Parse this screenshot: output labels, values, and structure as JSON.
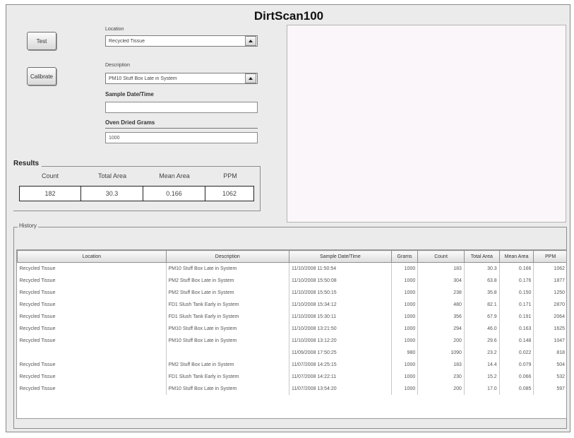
{
  "app": {
    "title": "DirtScan100"
  },
  "buttons": {
    "test_label": "Test",
    "calibrate_label": "Calibrate"
  },
  "location": {
    "label": "Location",
    "value": "Recycled Tissue"
  },
  "description": {
    "label": "Description",
    "value": "PM10 Stuff Box Late in System"
  },
  "sample_datetime": {
    "label": "Sample Date/Time",
    "value": ""
  },
  "oven_dried_grams": {
    "label": "Oven Dried Grams",
    "value": "1000"
  },
  "results": {
    "title": "Results",
    "headers": [
      "Count",
      "Total Area",
      "Mean Area",
      "PPM"
    ],
    "values": [
      "182",
      "30.3",
      "0.166",
      "1062"
    ]
  },
  "history": {
    "title": "History",
    "columns": [
      "Location",
      "Description",
      "Sample Date/Time",
      "Grams",
      "Count",
      "Total Area",
      "Mean Area",
      "PPM"
    ],
    "rows": [
      [
        "Recycled Tissue",
        "PM10 Stuff Box Late in System",
        "11/10/2008 11:50:54",
        "1000",
        "183",
        "30.3",
        "0.166",
        "1062"
      ],
      [
        "Recycled Tissue",
        "PM2 Stuff Box Late in System",
        "11/10/2008 15:50:08",
        "1000",
        "304",
        "63.8",
        "0.176",
        "1877"
      ],
      [
        "Recycled Tissue",
        "PM2 Stuff Box Late in System",
        "11/10/2008 15:50:15",
        "1000",
        "238",
        "35.8",
        "0.150",
        "1250"
      ],
      [
        "Recycled Tissue",
        "FD1 Slush Tank Early in System",
        "11/10/2008 15:34:12",
        "1000",
        "480",
        "82.1",
        "0.171",
        "2870"
      ],
      [
        "Recycled Tissue",
        "FD1 Slush Tank Early in System",
        "11/10/2008 15:30:11",
        "1000",
        "356",
        "67.9",
        "0.191",
        "2064"
      ],
      [
        "Recycled Tissue",
        "PM10 Stuff Box Late in System",
        "11/10/2008 13:21:50",
        "1000",
        "294",
        "46.0",
        "0.163",
        "1625"
      ],
      [
        "Recycled Tissue",
        "PM10 Stuff Box Late in System",
        "11/10/2008 13:12:20",
        "1000",
        "200",
        "29.6",
        "0.148",
        "1047"
      ],
      [
        "",
        "",
        "11/09/2008 17:50:25",
        "980",
        "1090",
        "23.2",
        "0.022",
        "818"
      ],
      [
        "Recycled Tissue",
        "PM2 Stuff Box Late in System",
        "11/07/2008 14:25:15",
        "1000",
        "183",
        "14.4",
        "0.079",
        "504"
      ],
      [
        "Recycled Tissue",
        "FD1 Slush Tank Early in System",
        "11/07/2008 14:22:11",
        "1000",
        "230",
        "15.2",
        "0.066",
        "532"
      ],
      [
        "Recycled Tissue",
        "PM10 Stuff Box Late in System",
        "11/07/2008 13:54:20",
        "1000",
        "200",
        "17.0",
        "0.085",
        "597"
      ]
    ]
  }
}
